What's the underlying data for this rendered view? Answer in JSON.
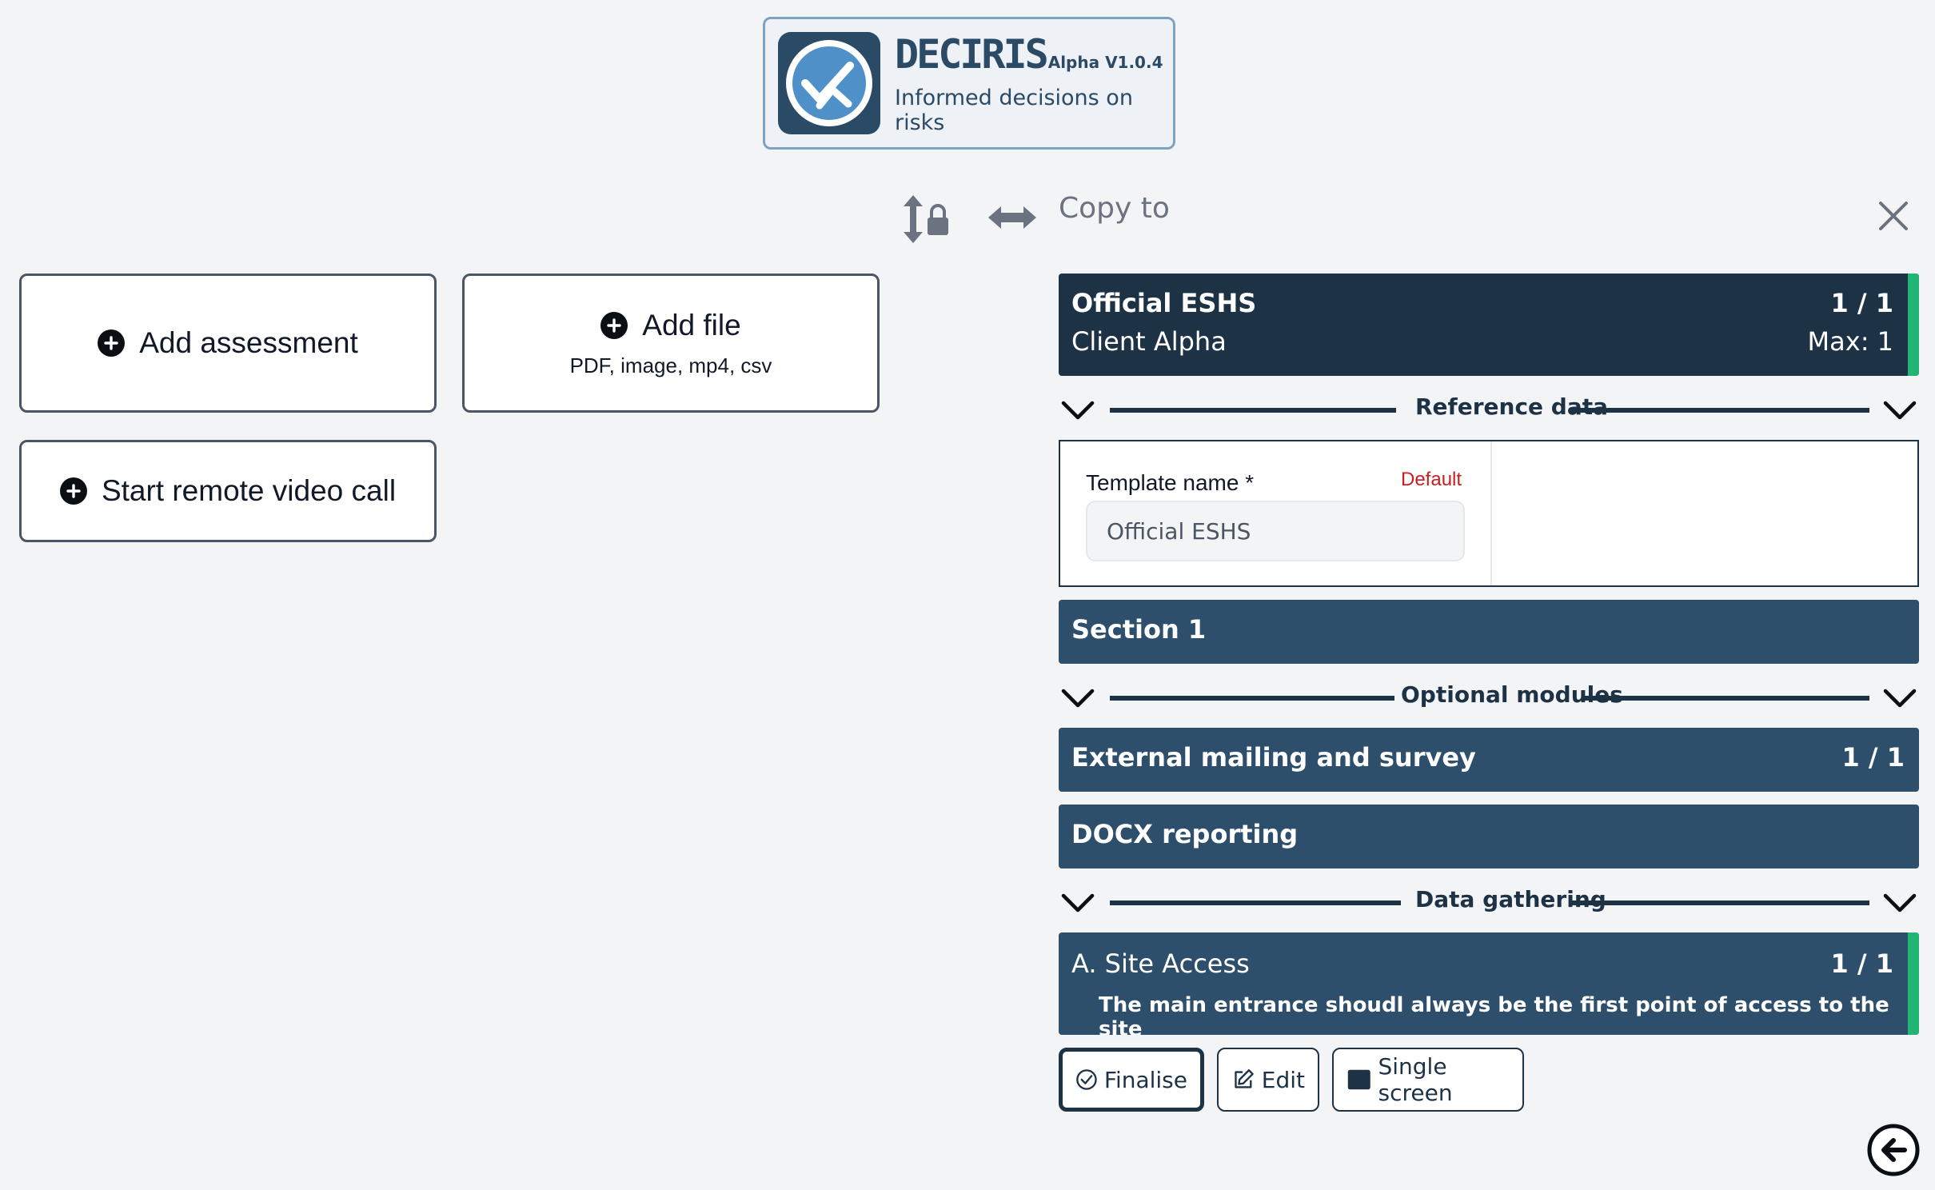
{
  "logo": {
    "brand": "DECIRIS",
    "version": "Alpha V1.0.4",
    "tagline": "Informed decisions on risks"
  },
  "left_actions": {
    "add_assessment": "Add assessment",
    "add_file": "Add file",
    "add_file_hint": "PDF, image, mp4, csv",
    "remote_call": "Start remote video call"
  },
  "toolbar": {
    "copy_to": "Copy to"
  },
  "header": {
    "title": "Official ESHS",
    "subtitle": "Client Alpha",
    "count": "1 / 1",
    "max": "Max: 1"
  },
  "dividers": {
    "reference": "Reference data",
    "optional": "Optional modules",
    "gathering": "Data gathering"
  },
  "template": {
    "label": "Template name *",
    "default_tag": "Default",
    "value": "Official ESHS"
  },
  "sections": {
    "section1": "Section 1",
    "external": "External mailing and survey",
    "external_count": "1 / 1",
    "docx": "DOCX reporting"
  },
  "site_access": {
    "title": "A. Site Access",
    "count": "1 / 1",
    "description": "The main entrance shoudl always be the first point of access to the site"
  },
  "actions": {
    "finalise": "Finalise",
    "edit": "Edit",
    "single_screen": "Single screen"
  },
  "colors": {
    "dark_navy": "#1e3246",
    "section_blue": "#2d4f6c",
    "accent_green": "#22b573",
    "required_red": "#c81e1e"
  }
}
